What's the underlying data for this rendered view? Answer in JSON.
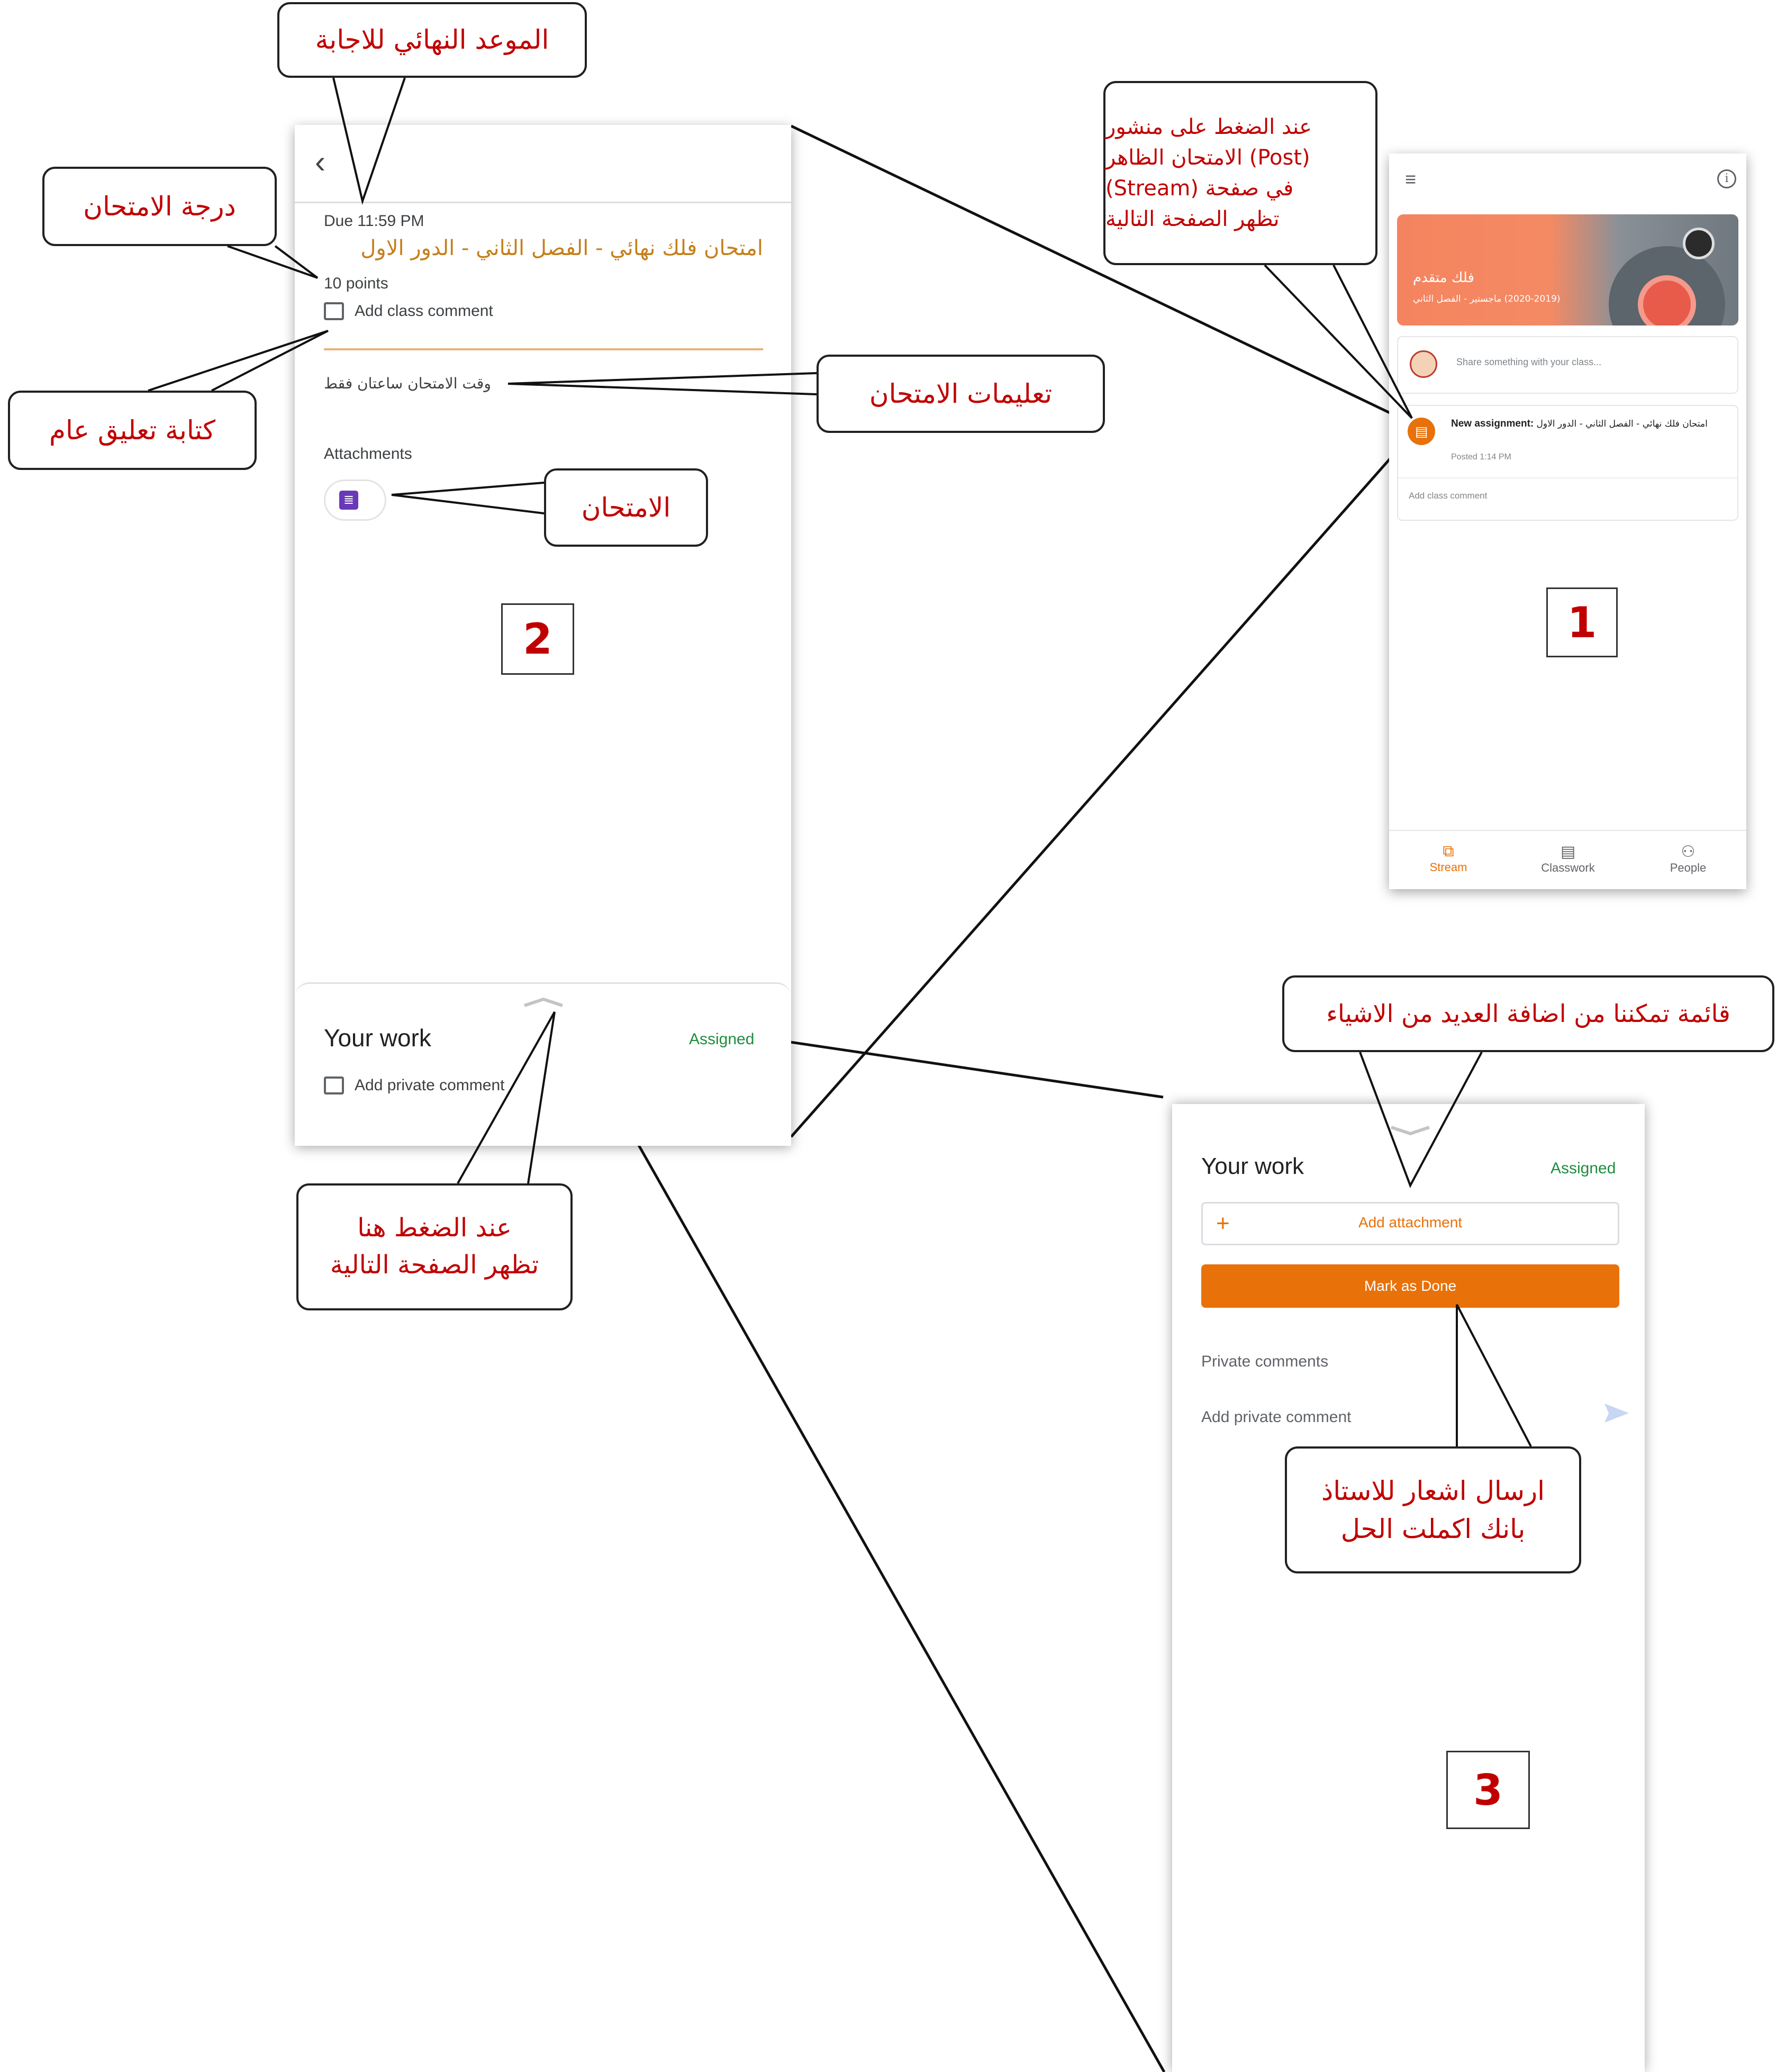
{
  "callouts": {
    "deadline": "الموعد النهائي للاجابة",
    "exam_grade": "درجة الامتحان",
    "post_click_line1": "عند الضغط على منشور",
    "post_click_line2": "(Post) الامتحان الظاهر",
    "post_click_line3": "في صفحة (Stream)",
    "post_click_line4": "تظهر الصفحة التالية",
    "general_comment": "كتابة تعليق عام",
    "exam_instructions": "تعليمات الامتحان",
    "the_exam": "الامتحان",
    "menu_add_items": "قائمة تمكننا من اضافة العديد من الاشياء",
    "click_here_line1": "عند الضغط هنا",
    "click_here_line2": "تظهر الصفحة التالية",
    "notify_teacher_line1": "ارسال اشعار للاستاذ",
    "notify_teacher_line2": "بانك اكملت الحل"
  },
  "step_numbers": {
    "one": "1",
    "two": "2",
    "three": "3"
  },
  "phone1": {
    "class_name": "فلك متقدم",
    "class_section": "(2020-2019) ماجستير - الفصل الثاني",
    "share_placeholder": "Share something with your class...",
    "post_prefix": "New assignment:",
    "post_title": "امتحان فلك نهائي - الفصل الثاني - الدور الاول",
    "post_time": "Posted 1:14 PM",
    "add_class_comment": "Add class comment",
    "nav": {
      "stream": "Stream",
      "classwork": "Classwork",
      "people": "People"
    },
    "colors": {
      "accent": "#e8710a",
      "banner": "#f4845f"
    }
  },
  "phone2": {
    "due": "Due 11:59 PM",
    "title": "امتحان فلك نهائي - الفصل الثاني - الدور الاول",
    "points": "10 points",
    "add_class_comment": "Add class comment",
    "instructions": "وقت الامتحان ساعتان فقط",
    "attachments_label": "Attachments",
    "your_work": "Your work",
    "status": "Assigned",
    "add_private_comment": "Add private comment",
    "colors": {
      "title": "#c5801b",
      "status": "#1e8e3e",
      "form_icon": "#673ab7"
    }
  },
  "phone3": {
    "your_work": "Your work",
    "status": "Assigned",
    "add_attachment": "Add attachment",
    "mark_done": "Mark as Done",
    "private_comments": "Private comments",
    "add_private_comment": "Add private comment",
    "colors": {
      "button": "#e8710a",
      "status": "#1e8e3e"
    }
  }
}
